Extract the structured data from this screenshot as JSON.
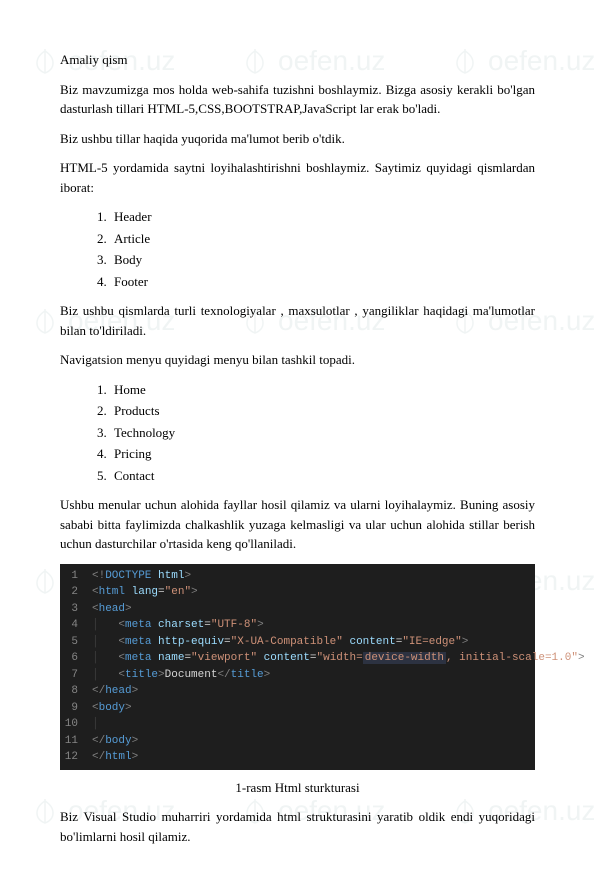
{
  "watermark": "oefen.uz",
  "heading": "Amaliy qism",
  "p1": "Biz mavzumizga mos holda web-sahifa tuzishni boshlaymiz. Bizga asosiy kerakli bo'lgan dasturlash tillari HTML-5,CSS,BOOTSTRAP,JavaScript lar erak bo'ladi.",
  "p2": "Biz ushbu tillar haqida yuqorida ma'lumot berib o'tdik.",
  "p3": "HTML-5 yordamida saytni loyihalashtirishni boshlaymiz. Saytimiz quyidagi qismlardan iborat:",
  "list1": [
    "Header",
    "Article",
    "Body",
    "Footer"
  ],
  "p4": "Biz ushbu qismlarda turli texnologiyalar , maxsulotlar , yangiliklar haqidagi ma'lumotlar bilan to'ldiriladi.",
  "p5": "Navigatsion menyu quyidagi menyu bilan tashkil topadi.",
  "list2": [
    "Home",
    "Products",
    "Technology",
    "Pricing",
    "Contact"
  ],
  "p6": "Ushbu menular uchun alohida fayllar hosil qilamiz va ularni loyihalaymiz. Buning asosiy sababi bitta faylimizda chalkashlik yuzaga kelmasligi va ular uchun alohida stillar berish uchun dasturchilar o'rtasida keng qo'llaniladi.",
  "caption": "1-rasm Html sturkturasi",
  "p7": "Biz Visual Studio muharriri yordamida html strukturasini yaratib oldik endi yuqoridagi bo'limlarni hosil qilamiz.",
  "code": {
    "lines": [
      {
        "n": "1",
        "html": "<span class='tok-bracket'>&lt;!</span><span class='tok-tag'>DOCTYPE</span> <span class='tok-attr'>html</span><span class='tok-bracket'>&gt;</span>"
      },
      {
        "n": "2",
        "html": "<span class='tok-bracket'>&lt;</span><span class='tok-tag'>html</span> <span class='tok-attr'>lang</span>=<span class='tok-string'>\"en\"</span><span class='tok-bracket'>&gt;</span>"
      },
      {
        "n": "3",
        "html": "<span class='tok-bracket'>&lt;</span><span class='tok-tag'>head</span><span class='tok-bracket'>&gt;</span>"
      },
      {
        "n": "4",
        "html": "<span class='indent-guide'>│   </span><span class='tok-bracket'>&lt;</span><span class='tok-tag'>meta</span> <span class='tok-attr'>charset</span>=<span class='tok-string'>\"UTF-8\"</span><span class='tok-bracket'>&gt;</span>"
      },
      {
        "n": "5",
        "html": "<span class='indent-guide'>│   </span><span class='tok-bracket'>&lt;</span><span class='tok-tag'>meta</span> <span class='tok-attr'>http-equiv</span>=<span class='tok-string'>\"X-UA-Compatible\"</span> <span class='tok-attr'>content</span>=<span class='tok-string'>\"IE=edge\"</span><span class='tok-bracket'>&gt;</span>"
      },
      {
        "n": "6",
        "html": "<span class='indent-guide'>│   </span><span class='tok-bracket'>&lt;</span><span class='tok-tag'>meta</span> <span class='tok-attr'>name</span>=<span class='tok-string'>\"viewport\"</span> <span class='tok-attr'>content</span>=<span class='tok-string'>\"width=<span class='highlight-box'>device-width</span>, initial-scale=1.0\"</span><span class='tok-bracket'>&gt;</span>"
      },
      {
        "n": "7",
        "html": "<span class='indent-guide'>│   </span><span class='tok-bracket'>&lt;</span><span class='tok-tag'>title</span><span class='tok-bracket'>&gt;</span><span class='tok-text'>Document</span><span class='tok-bracket'>&lt;/</span><span class='tok-tag'>title</span><span class='tok-bracket'>&gt;</span>"
      },
      {
        "n": "8",
        "html": "<span class='tok-bracket'>&lt;/</span><span class='tok-tag'>head</span><span class='tok-bracket'>&gt;</span>"
      },
      {
        "n": "9",
        "html": "<span class='tok-bracket'>&lt;</span><span class='tok-tag'>body</span><span class='tok-bracket'>&gt;</span>"
      },
      {
        "n": "10",
        "html": "<span class='indent-guide'>│   </span>"
      },
      {
        "n": "11",
        "html": "<span class='tok-bracket'>&lt;/</span><span class='tok-tag'>body</span><span class='tok-bracket'>&gt;</span>"
      },
      {
        "n": "12",
        "html": "<span class='tok-bracket'>&lt;/</span><span class='tok-tag'>html</span><span class='tok-bracket'>&gt;</span>"
      }
    ]
  }
}
